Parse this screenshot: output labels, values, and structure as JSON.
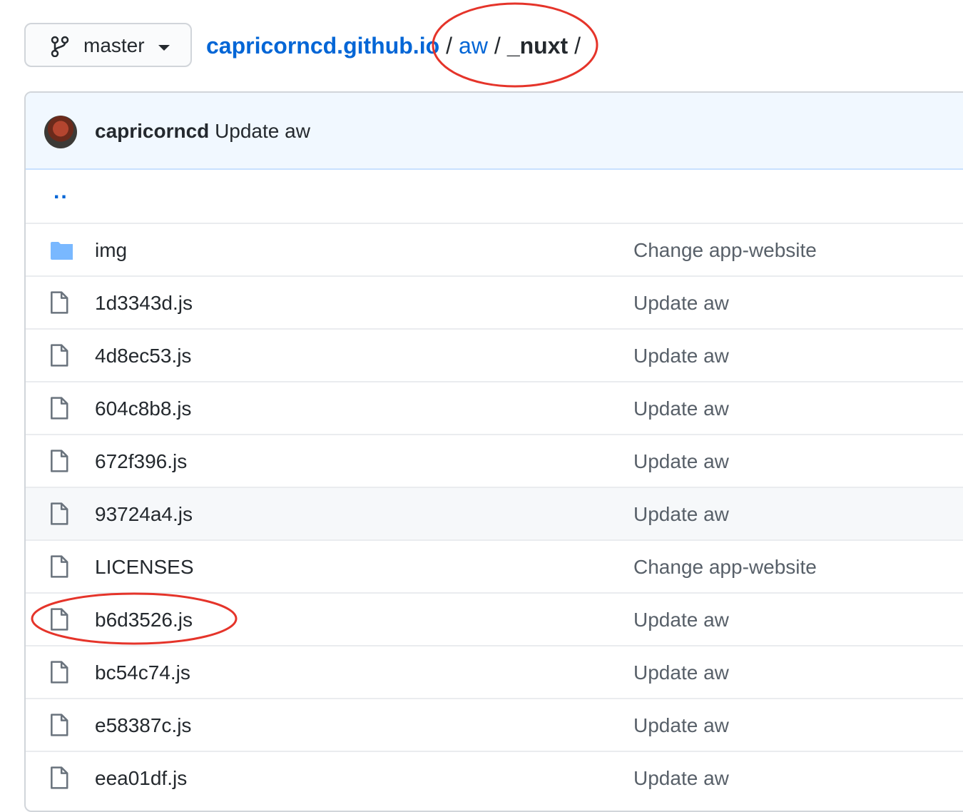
{
  "branch": {
    "label": "master",
    "icon": "git-branch-icon"
  },
  "breadcrumb": {
    "repo": "capricorncd.github.io",
    "sep1": "/",
    "dir": "aw",
    "sep2": "/",
    "current": "_nuxt",
    "sep3": "/"
  },
  "commit": {
    "author": "capricorncd",
    "message": "Update aw"
  },
  "parent_link": "..",
  "files": [
    {
      "name": "img",
      "type": "folder",
      "message": "Change app-website"
    },
    {
      "name": "1d3343d.js",
      "type": "file",
      "message": "Update aw"
    },
    {
      "name": "4d8ec53.js",
      "type": "file",
      "message": "Update aw"
    },
    {
      "name": "604c8b8.js",
      "type": "file",
      "message": "Update aw"
    },
    {
      "name": "672f396.js",
      "type": "file",
      "message": "Update aw"
    },
    {
      "name": "93724a4.js",
      "type": "file",
      "message": "Update aw"
    },
    {
      "name": "LICENSES",
      "type": "file",
      "message": "Change app-website"
    },
    {
      "name": "b6d3526.js",
      "type": "file",
      "message": "Update aw"
    },
    {
      "name": "bc54c74.js",
      "type": "file",
      "message": "Update aw"
    },
    {
      "name": "e58387c.js",
      "type": "file",
      "message": "Update aw"
    },
    {
      "name": "eea01df.js",
      "type": "file",
      "message": "Update aw"
    }
  ],
  "colors": {
    "link": "#0366d6",
    "annotation": "#e5342a",
    "header_bg": "#f1f8ff"
  }
}
